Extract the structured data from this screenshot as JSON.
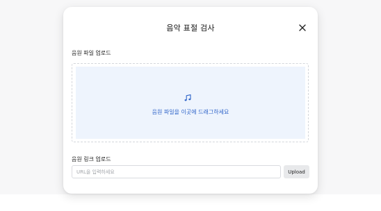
{
  "modal": {
    "title": "음악 표절 검사",
    "close_icon": "close-icon"
  },
  "file_upload": {
    "label": "음원 파일 업로드",
    "icon": "music-note-icon",
    "accent_color": "#2f64c9",
    "dropzone_bg": "#eef4fd",
    "drop_text": "음원 파일을 이곳에 드래그하세요"
  },
  "link_upload": {
    "label": "음원 링크 업로드",
    "input_value": "",
    "input_placeholder": "URL을 입력하세요",
    "button_label": "Upload"
  }
}
